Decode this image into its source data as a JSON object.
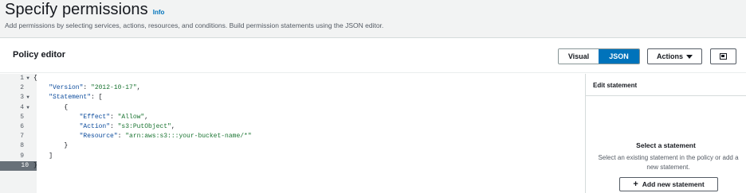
{
  "page": {
    "title": "Specify permissions",
    "info_link": "Info",
    "description": "Add permissions by selecting services, actions, resources, and conditions. Build permission statements using the JSON editor."
  },
  "policy_editor": {
    "title": "Policy editor",
    "toggle": {
      "visual_label": "Visual",
      "json_label": "JSON",
      "selected": "JSON"
    },
    "actions_label": "Actions",
    "active_line": 10,
    "lines": [
      {
        "num": "1",
        "fold": "▼",
        "code": "{"
      },
      {
        "num": "2",
        "fold": "",
        "code": "    \"Version\": \"2012-10-17\","
      },
      {
        "num": "3",
        "fold": "▼",
        "code": "    \"Statement\": ["
      },
      {
        "num": "4",
        "fold": "▼",
        "code": "        {"
      },
      {
        "num": "5",
        "fold": "",
        "code": "            \"Effect\": \"Allow\","
      },
      {
        "num": "6",
        "fold": "",
        "code": "            \"Action\": \"s3:PutObject\","
      },
      {
        "num": "7",
        "fold": "",
        "code": "            \"Resource\": \"arn:aws:s3:::your-bucket-name/*\""
      },
      {
        "num": "8",
        "fold": "",
        "code": "        }"
      },
      {
        "num": "9",
        "fold": "",
        "code": "    ]"
      },
      {
        "num": "10",
        "fold": "",
        "code": "}"
      }
    ]
  },
  "edit_statement": {
    "title": "Edit statement",
    "subtitle": "Select a statement",
    "description": "Select an existing statement in the policy or add a new statement.",
    "add_button": "Add new statement"
  },
  "colors": {
    "accent": "#0073bb",
    "json_string": "#1a7431",
    "json_key": "#0a4a9c"
  },
  "icons": {
    "fold": "chevron-down-icon",
    "panel": "split-panel-icon",
    "add": "plus-icon"
  }
}
